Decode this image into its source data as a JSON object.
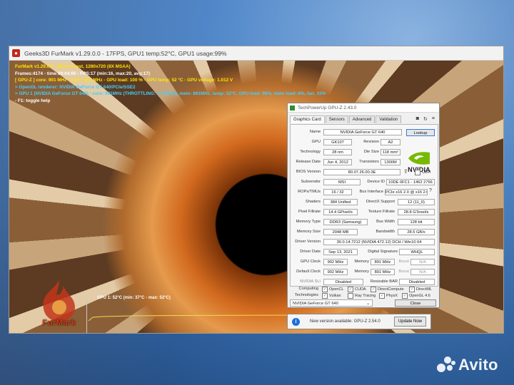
{
  "furmark": {
    "title": "Geeks3D FurMark v1.29.0.0 - 17FPS, GPU1 temp:52°C, GPU1 usage:99%",
    "overlay": [
      {
        "text": "FurMark v1.29.0.0 - Burn-in test, 1280x720 (8X MSAA)",
        "color": "yellow"
      },
      {
        "text": "Frames:4174 - time:00:04:05 - FPS:17 (min:16, max:20, avg:17)",
        "color": "white"
      },
      {
        "text": "[ GPU-Z ] core: 901 MHz - mem: 891 MHz - GPU load: 100 % - GPU temp: 52 °C - GPU voltage: 1.012 V",
        "color": "yellow"
      },
      {
        "text": "> OpenGL renderer: NVIDIA GeForce GT 640/PCIe/SSE2",
        "color": "cyan"
      },
      {
        "text": "> GPU 1 (NVIDIA GeForce GT 640) - core: 901MHz (THROTTLING: -571MHz), mem: 891MHz, temp: 52°C, GPU load: 99%, mem load: 8%, fan: 33%",
        "color": "cyan"
      },
      {
        "text": "- F1: toggle help",
        "color": "white"
      }
    ],
    "graph_label": "GPU 1: 52°C (min: 37°C - max: 52°C)",
    "logo_text": "FurMark"
  },
  "gpuz": {
    "title": "TechPowerUp GPU-Z 2.43.0",
    "tabs": [
      "Graphics Card",
      "Sensors",
      "Advanced",
      "Validation"
    ],
    "labels": {
      "name": "Name",
      "gpu": "GPU",
      "revision": "Revision",
      "technology": "Technology",
      "die_size": "Die Size",
      "release_date": "Release Date",
      "transistors": "Transistors",
      "bios_version": "BIOS Version",
      "uefi": "UEFI",
      "subvendor": "Subvendor",
      "device_id": "Device ID",
      "rops_tmus": "ROPs/TMUs",
      "bus_interface": "Bus Interface",
      "shaders": "Shaders",
      "directx_support": "DirectX Support",
      "pixel_fillrate": "Pixel Fillrate",
      "texture_fillrate": "Texture Fillrate",
      "memory_type": "Memory Type",
      "bus_width": "Bus Width",
      "memory_size": "Memory Size",
      "bandwidth": "Bandwidth",
      "driver_version": "Driver Version",
      "driver_date": "Driver Date",
      "digital_signature": "Digital Signature",
      "gpu_clock": "GPU Clock",
      "memory": "Memory",
      "boost": "Boost",
      "default_clock": "Default Clock",
      "nvidia_sli": "NVIDIA SLI",
      "resizable_bar": "Resizable BAR",
      "computing": "Computing",
      "technologies": "Technologies"
    },
    "values": {
      "name": "NVIDIA GeForce GT 640",
      "gpu": "GK107",
      "revision": "A2",
      "technology": "28 nm",
      "die_size": "118 mm²",
      "release_date": "Jun 4, 2012",
      "transistors": "1300M",
      "bios_version": "80.07.26.00.3E",
      "subvendor": "MSI",
      "device_id": "10DE 0FC1 - 1462 2756",
      "rops_tmus": "16 / 32",
      "bus_interface": "PCIe x16 2.0 @ x16 2.0",
      "shaders": "384 Unified",
      "directx_support": "12 (11_0)",
      "pixel_fillrate": "14.4 GPixel/s",
      "texture_fillrate": "28.8 GTexel/s",
      "memory_type": "DDR3 (Samsung)",
      "bus_width": "128 bit",
      "memory_size": "2048 MB",
      "bandwidth": "28.5 GB/s",
      "driver_version": "30.0.14.7212 (NVIDIA 472.12) DCH / Win10 64",
      "driver_date": "Sep 13, 2021",
      "digital_signature": "WHQL",
      "gpu_clock": "902 MHz",
      "memory_clock": "891 MHz",
      "boost": "N/A",
      "default_clock": "902 MHz",
      "default_memory": "891 MHz",
      "default_boost": "N/A",
      "nvidia_sli": "Disabled",
      "resizable_bar": "Disabled"
    },
    "computing": [
      "OpenCL",
      "CUDA",
      "DirectCompute",
      "DirectML"
    ],
    "technologies": [
      "Vulkan",
      "Ray Tracing",
      "PhysX",
      "OpenGL 4.6"
    ],
    "lookup_label": "Lookup",
    "close_label": "Close",
    "selected_card": "NVIDIA GeForce GT 640",
    "logo_text": "NVIDIA"
  },
  "notification": {
    "text": "New version available: GPU-Z 2.54.0",
    "button": "Update Now"
  },
  "watermark": "Avito"
}
